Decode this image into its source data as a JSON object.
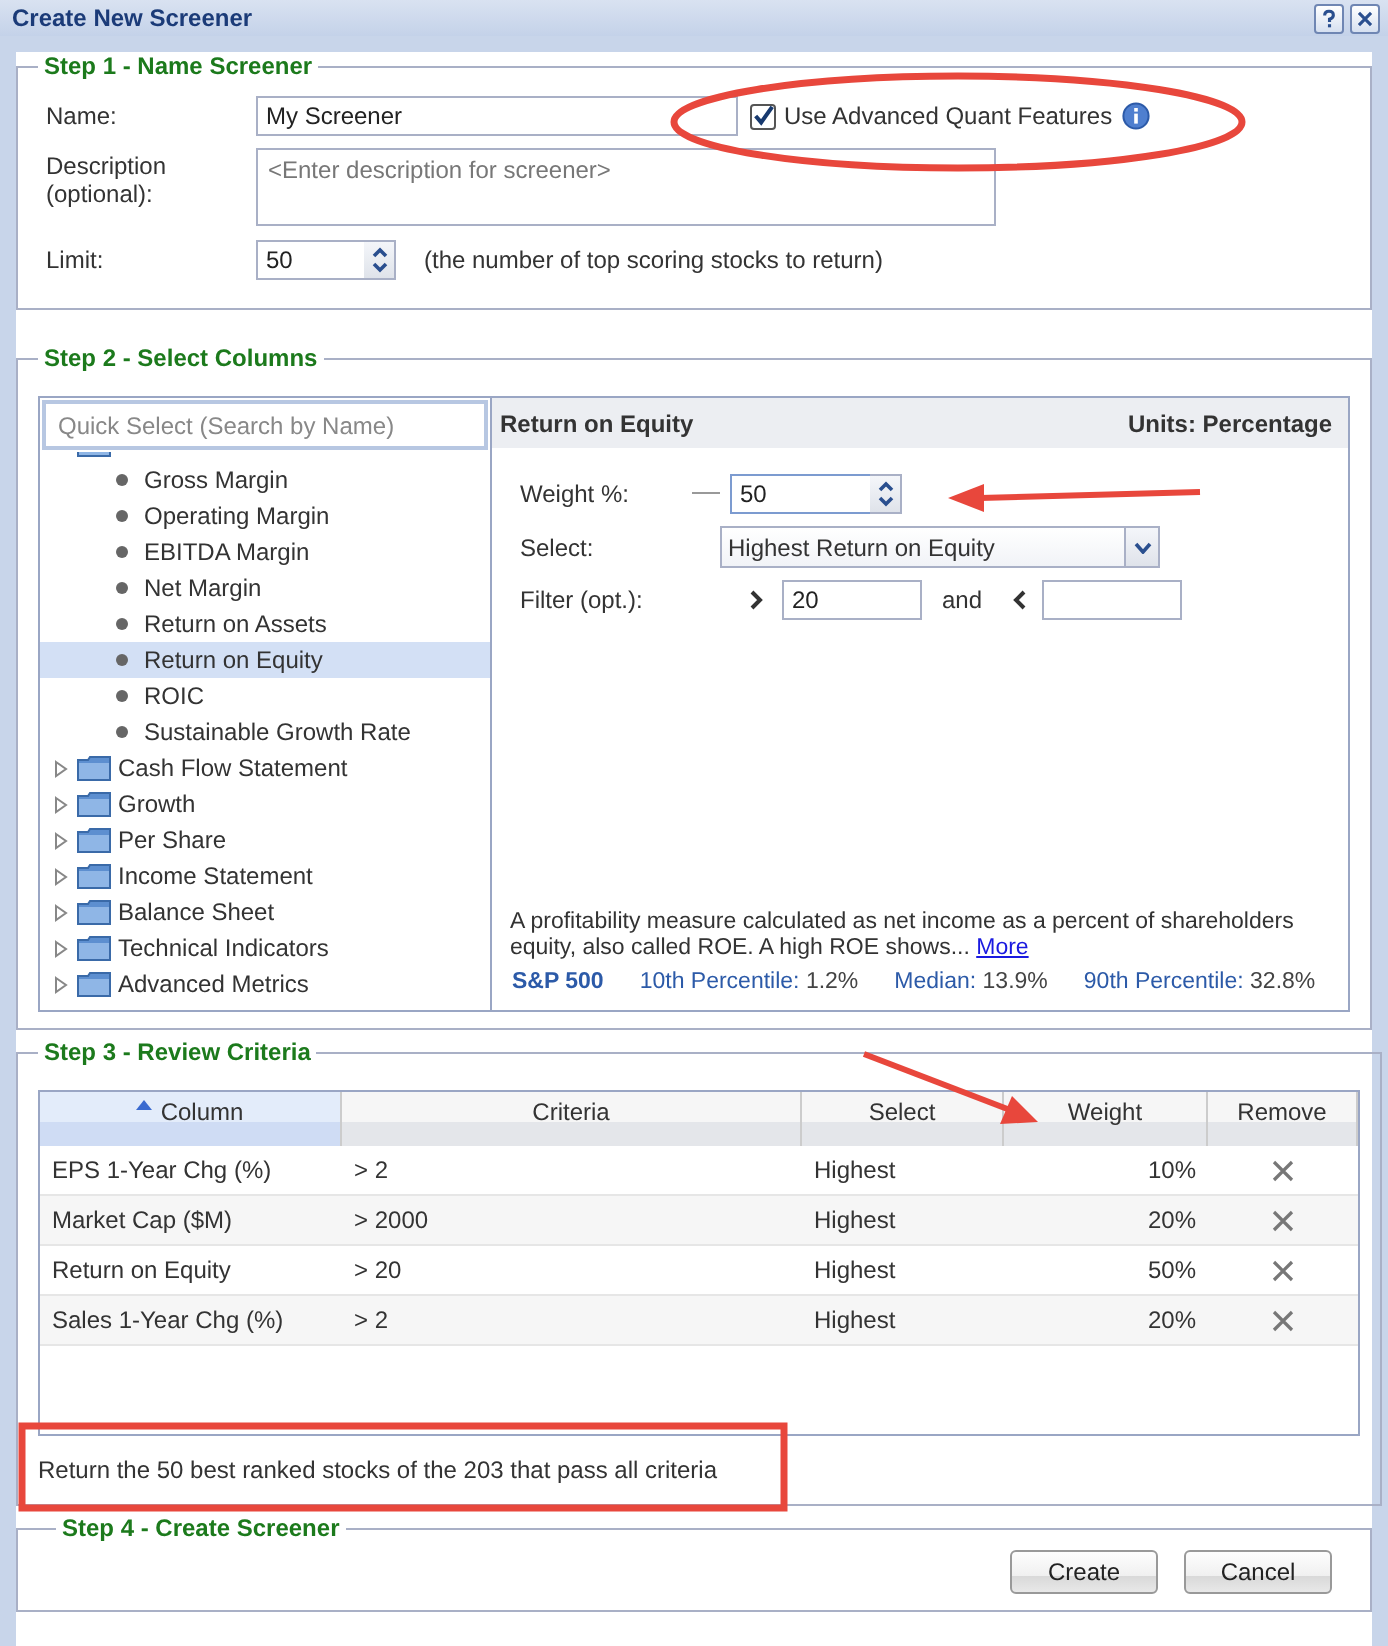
{
  "window": {
    "title": "Create New Screener"
  },
  "step1": {
    "legend": "Step 1 - Name Screener",
    "name_label": "Name:",
    "name_value": "My Screener",
    "advanced": {
      "label": "Use Advanced Quant Features",
      "checked": true
    },
    "description_label": "Description (optional):",
    "description_placeholder": "<Enter description for screener>",
    "limit_label": "Limit:",
    "limit_value": "50",
    "limit_hint": "(the number of top scoring stocks to return)"
  },
  "step2": {
    "legend": "Step 2 - Select Columns",
    "search": {
      "placeholder": "Quick Select (Search by Name)"
    },
    "tree": [
      {
        "kind": "folder",
        "expanded": true,
        "children": [
          {
            "label": "Gross Margin",
            "selected": false
          },
          {
            "label": "Operating Margin",
            "selected": false
          },
          {
            "label": "EBITDA Margin",
            "selected": false
          },
          {
            "label": "Net Margin",
            "selected": false
          },
          {
            "label": "Return on Assets",
            "selected": false
          },
          {
            "label": "Return on Equity",
            "selected": true
          },
          {
            "label": "ROIC",
            "selected": false
          },
          {
            "label": "Sustainable Growth Rate",
            "selected": false
          }
        ]
      },
      {
        "kind": "folder",
        "label": "Cash Flow Statement",
        "expanded": false
      },
      {
        "kind": "folder",
        "label": "Growth",
        "expanded": false
      },
      {
        "kind": "folder",
        "label": "Per Share",
        "expanded": false
      },
      {
        "kind": "folder",
        "label": "Income Statement",
        "expanded": false
      },
      {
        "kind": "folder",
        "label": "Balance Sheet",
        "expanded": false
      },
      {
        "kind": "folder",
        "label": "Technical Indicators",
        "expanded": false
      },
      {
        "kind": "folder",
        "label": "Advanced Metrics",
        "expanded": false
      }
    ],
    "detail": {
      "title": "Return on Equity",
      "units": "Units: Percentage",
      "weight_label": "Weight %:",
      "weight_value": "50",
      "select_label": "Select:",
      "select_value": "Highest Return on Equity",
      "filter_label": "Filter (opt.):",
      "filter_min": "20",
      "filter_and": "and",
      "description": "A profitability measure calculated as net income as a percent of shareholders equity, also called ROE. A high ROE shows...",
      "more_link": "More",
      "index_label": "S&P 500",
      "stats": [
        {
          "label": "10th Percentile:",
          "value": "1.2%"
        },
        {
          "label": "Median:",
          "value": "13.9%"
        },
        {
          "label": "90th Percentile:",
          "value": "32.8%"
        }
      ]
    }
  },
  "step3": {
    "legend": "Step 3 - Review Criteria",
    "columns": [
      {
        "label": "Column",
        "sorted": true
      },
      {
        "label": "Criteria",
        "sorted": false
      },
      {
        "label": "Select",
        "sorted": false
      },
      {
        "label": "Weight",
        "sorted": false
      },
      {
        "label": "Remove",
        "sorted": false
      }
    ],
    "rows": [
      {
        "column": "EPS 1-Year Chg (%)",
        "criteria": "> 2",
        "select": "Highest",
        "weight": "10%"
      },
      {
        "column": "Market Cap ($M)",
        "criteria": "> 2000",
        "select": "Highest",
        "weight": "20%"
      },
      {
        "column": "Return on Equity",
        "criteria": "> 20",
        "select": "Highest",
        "weight": "50%"
      },
      {
        "column": "Sales 1-Year Chg (%)",
        "criteria": "> 2",
        "select": "Highest",
        "weight": "20%"
      }
    ],
    "summary": "Return the 50 best ranked stocks of the 203 that pass all criteria"
  },
  "step4": {
    "legend": "Step 4 - Create Screener",
    "buttons": [
      "Create",
      "Cancel"
    ]
  },
  "annotations": [
    {
      "kind": "ellipse"
    },
    {
      "kind": "arrow"
    },
    {
      "kind": "arrow"
    },
    {
      "kind": "rectangle"
    }
  ]
}
